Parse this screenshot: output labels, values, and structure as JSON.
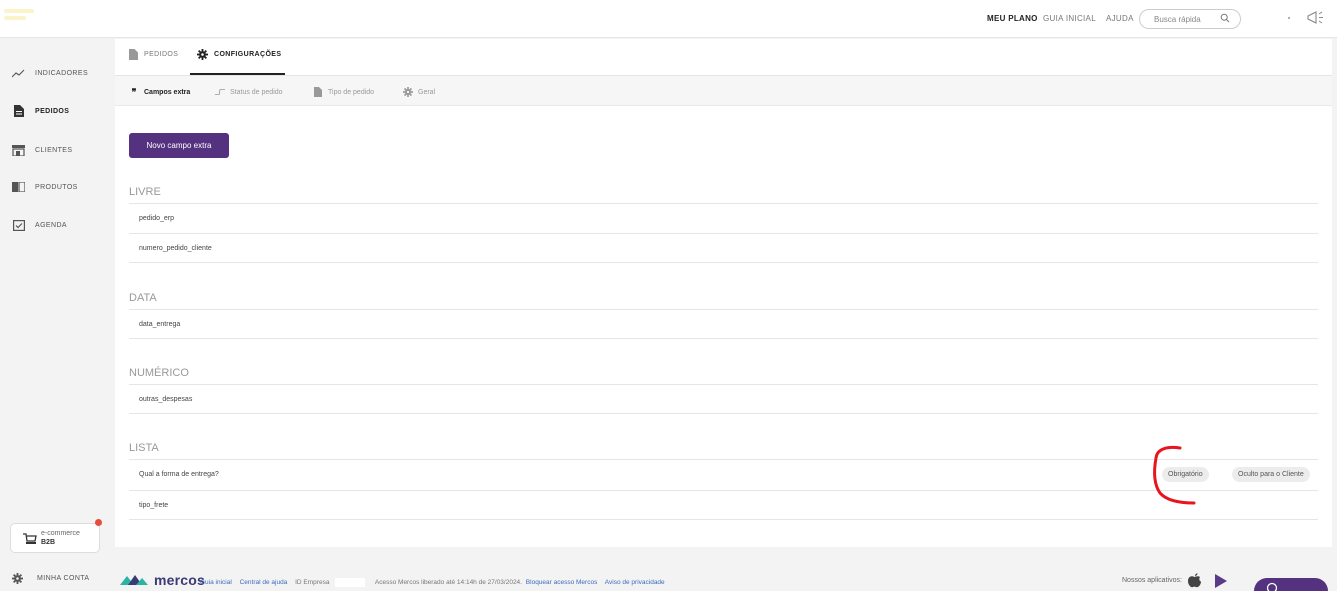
{
  "topbar": {
    "meu_plano": "MEU PLANO",
    "guia_inicial": "GUIA INICIAL",
    "ajuda": "AJUDA",
    "search_placeholder": "Busca rápida"
  },
  "sidebar": {
    "items": [
      {
        "label": "INDICADORES",
        "icon": "trend-line-icon"
      },
      {
        "label": "PEDIDOS",
        "icon": "document-icon"
      },
      {
        "label": "CLIENTES",
        "icon": "store-icon"
      },
      {
        "label": "PRODUTOS",
        "icon": "book-icon"
      },
      {
        "label": "AGENDA",
        "icon": "calendar-check-icon"
      }
    ],
    "active": "PEDIDOS",
    "ecommerce": {
      "line1": "e-commerce",
      "line2": "B2B"
    },
    "account": "MINHA CONTA"
  },
  "tabs": {
    "primary": [
      {
        "label": "PEDIDOS",
        "icon": "document-icon"
      },
      {
        "label": "CONFIGURAÇÕES",
        "icon": "gear-icon"
      }
    ],
    "secondary": [
      {
        "label": "Campos extra",
        "icon": "quote-icon"
      },
      {
        "label": "Status de pedido",
        "icon": "status-flow-icon"
      },
      {
        "label": "Tipo de pedido",
        "icon": "document-icon"
      },
      {
        "label": "Geral",
        "icon": "gear-icon"
      }
    ]
  },
  "main": {
    "new_button": "Novo campo extra",
    "sections": [
      {
        "title": "LIVRE",
        "rows": [
          {
            "name": "pedido_erp"
          },
          {
            "name": "numero_pedido_cliente"
          }
        ]
      },
      {
        "title": "DATA",
        "rows": [
          {
            "name": "data_entrega"
          }
        ]
      },
      {
        "title": "NUMÉRICO",
        "rows": [
          {
            "name": "outras_despesas"
          }
        ]
      },
      {
        "title": "LISTA",
        "rows": [
          {
            "name": "Qual a forma de entrega?",
            "tags": [
              "Obrigatório",
              "Oculto para o Cliente"
            ]
          },
          {
            "name": "tipo_frete"
          }
        ]
      }
    ]
  },
  "footer": {
    "logo": "mercos",
    "guia_inicial": "Guia inicial",
    "central_ajuda": "Central de ajuda",
    "id_empresa": "ID Empresa",
    "acesso_text": "Acesso Mercos liberado até 14:14h de 27/03/2024.",
    "bloquear": "Bloquear acesso Mercos",
    "privacidade": "Aviso de privacidade",
    "apps_label": "Nossos aplicativos:"
  },
  "colors": {
    "primary": "#55327f",
    "annotation": "#e8141e",
    "link": "#3b6bbf"
  }
}
